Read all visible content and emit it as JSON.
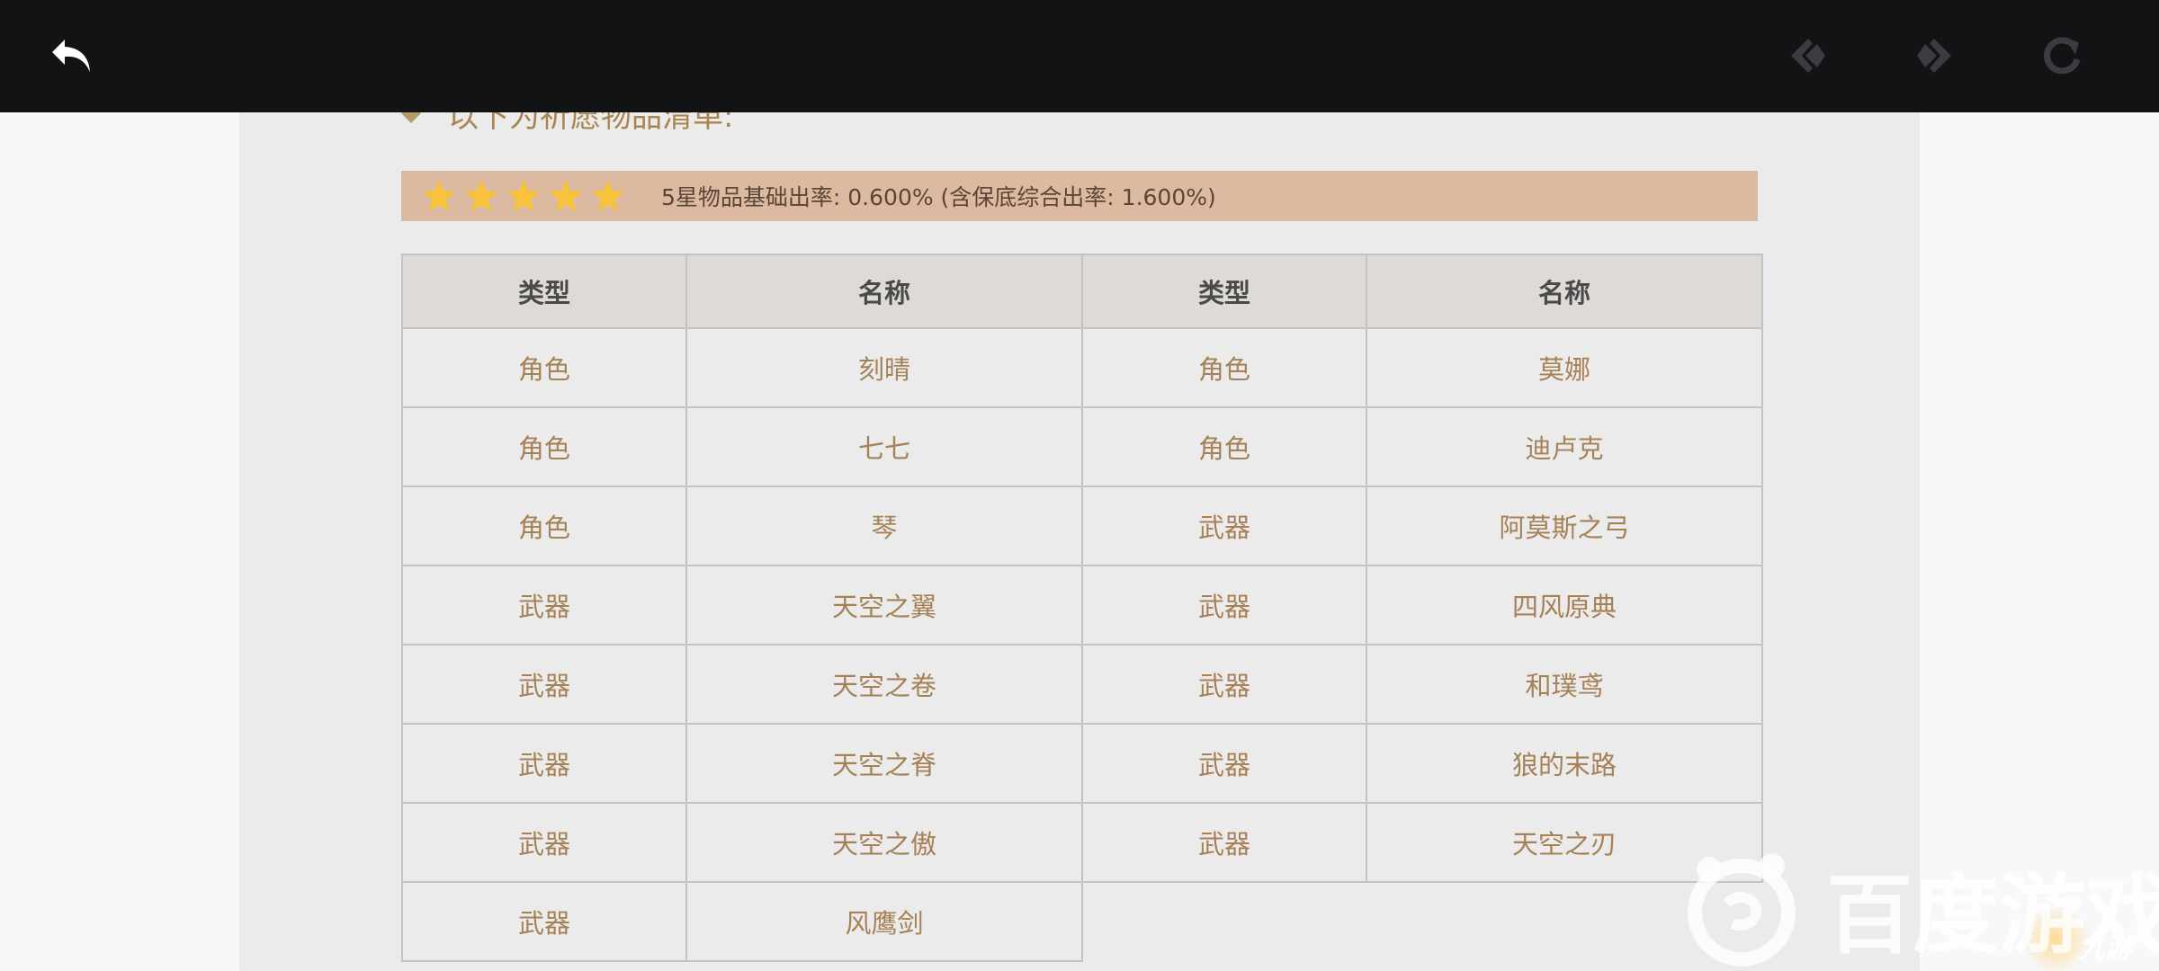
{
  "toolbar": {
    "back_icon": "back-arrow-icon",
    "prev_icon": "prev-diamond-icon",
    "next_icon": "next-diamond-icon",
    "reload_icon": "reload-icon"
  },
  "intro_text": "以下为祈愿物品清单:",
  "rate": {
    "stars": 5,
    "text": "5星物品基础出率:  0.600% (含保底综合出率: 1.600%)"
  },
  "table": {
    "headers": [
      "类型",
      "名称",
      "类型",
      "名称"
    ],
    "rows": [
      [
        "角色",
        "刻晴",
        "角色",
        "莫娜"
      ],
      [
        "角色",
        "七七",
        "角色",
        "迪卢克"
      ],
      [
        "角色",
        "琴",
        "武器",
        "阿莫斯之弓"
      ],
      [
        "武器",
        "天空之翼",
        "武器",
        "四风原典"
      ],
      [
        "武器",
        "天空之卷",
        "武器",
        "和璞鸢"
      ],
      [
        "武器",
        "天空之脊",
        "武器",
        "狼的末路"
      ],
      [
        "武器",
        "天空之傲",
        "武器",
        "天空之刃"
      ],
      [
        "武器",
        "风鹰剑"
      ]
    ]
  },
  "watermark": {
    "brand": "百度游戏",
    "sub": "九游"
  },
  "colors": {
    "topbar": "#121315",
    "content_bg": "#ebebeb",
    "rate_bar": "#dcb9a1",
    "star": "#f6c33a",
    "cell_text": "#a68156",
    "header_bg": "#dedbd6"
  }
}
